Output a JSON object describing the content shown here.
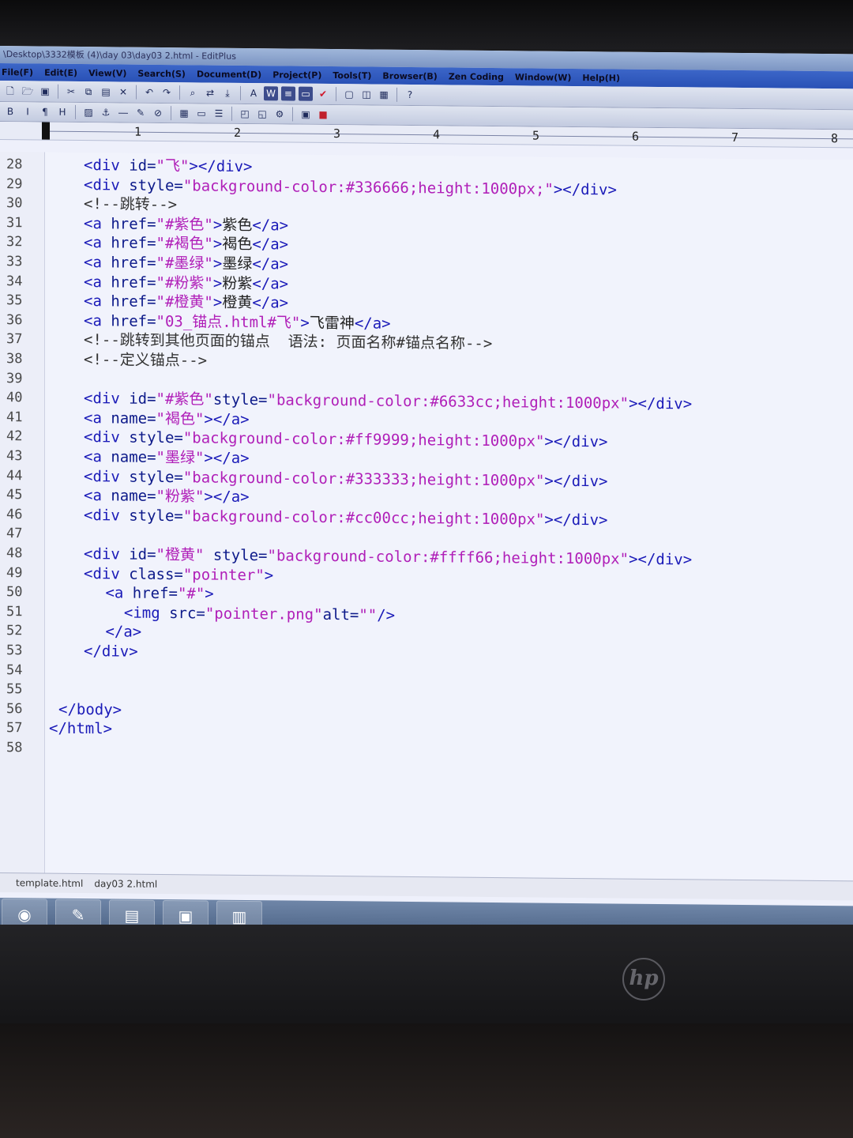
{
  "window": {
    "title": "\\Desktop\\3332模板 (4)\\day 03\\day03 2.html - EditPlus"
  },
  "menu": [
    "File(F)",
    "Edit(E)",
    "View(V)",
    "Search(S)",
    "Document(D)",
    "Project(P)",
    "Tools(T)",
    "Browser(B)",
    "Zen Coding",
    "Window(W)",
    "Help(H)"
  ],
  "ruler": [
    "1",
    "2",
    "3",
    "4",
    "5",
    "6",
    "7",
    "8"
  ],
  "lines": [
    {
      "n": "28",
      "code": [
        [
          "tag",
          "<div "
        ],
        [
          "attr",
          "id="
        ],
        [
          "str",
          "\"飞\""
        ],
        [
          "tag",
          "></div>"
        ]
      ]
    },
    {
      "n": "29",
      "code": [
        [
          "tag",
          "<div "
        ],
        [
          "attr",
          "style="
        ],
        [
          "str",
          "\"background-color:#336666;height:1000px;\""
        ],
        [
          "tag",
          "></div>"
        ]
      ]
    },
    {
      "n": "30",
      "code": [
        [
          "cmt",
          "<!--跳转-->"
        ]
      ]
    },
    {
      "n": "31",
      "code": [
        [
          "tag",
          "<a "
        ],
        [
          "attr",
          "href="
        ],
        [
          "str",
          "\"#紫色\""
        ],
        [
          "tag",
          ">"
        ],
        [
          "txt",
          "紫色"
        ],
        [
          "tag",
          "</a>"
        ]
      ]
    },
    {
      "n": "32",
      "code": [
        [
          "tag",
          "<a "
        ],
        [
          "attr",
          "href="
        ],
        [
          "str",
          "\"#褐色\""
        ],
        [
          "tag",
          ">"
        ],
        [
          "txt",
          "褐色"
        ],
        [
          "tag",
          "</a>"
        ]
      ]
    },
    {
      "n": "33",
      "code": [
        [
          "tag",
          "<a "
        ],
        [
          "attr",
          "href="
        ],
        [
          "str",
          "\"#墨绿\""
        ],
        [
          "tag",
          ">"
        ],
        [
          "txt",
          "墨绿"
        ],
        [
          "tag",
          "</a>"
        ]
      ]
    },
    {
      "n": "34",
      "code": [
        [
          "tag",
          "<a "
        ],
        [
          "attr",
          "href="
        ],
        [
          "str",
          "\"#粉紫\""
        ],
        [
          "tag",
          ">"
        ],
        [
          "txt",
          "粉紫"
        ],
        [
          "tag",
          "</a>"
        ]
      ]
    },
    {
      "n": "35",
      "code": [
        [
          "tag",
          "<a "
        ],
        [
          "attr",
          "href="
        ],
        [
          "str",
          "\"#橙黄\""
        ],
        [
          "tag",
          ">"
        ],
        [
          "txt",
          "橙黄"
        ],
        [
          "tag",
          "</a>"
        ]
      ]
    },
    {
      "n": "36",
      "code": [
        [
          "tag",
          "<a "
        ],
        [
          "attr",
          "href="
        ],
        [
          "str",
          "\"03_锚点.html#飞\""
        ],
        [
          "tag",
          ">"
        ],
        [
          "txt",
          "飞雷神"
        ],
        [
          "tag",
          "</a>"
        ]
      ]
    },
    {
      "n": "37",
      "code": [
        [
          "cmt",
          "<!--跳转到其他页面的锚点  语法: 页面名称#锚点名称-->"
        ]
      ]
    },
    {
      "n": "38",
      "code": [
        [
          "cmt",
          "<!--定义锚点-->"
        ]
      ]
    },
    {
      "n": "39",
      "code": []
    },
    {
      "n": "40",
      "code": [
        [
          "tag",
          "<div "
        ],
        [
          "attr",
          "id="
        ],
        [
          "str",
          "\"#紫色\""
        ],
        [
          "attr",
          "style="
        ],
        [
          "str",
          "\"background-color:#6633cc;height:1000px\""
        ],
        [
          "tag",
          "></div>"
        ]
      ]
    },
    {
      "n": "41",
      "code": [
        [
          "tag",
          "<a "
        ],
        [
          "attr",
          "name="
        ],
        [
          "str",
          "\"褐色\""
        ],
        [
          "tag",
          "></a>"
        ]
      ]
    },
    {
      "n": "42",
      "code": [
        [
          "tag",
          "<div "
        ],
        [
          "attr",
          "style="
        ],
        [
          "str",
          "\"background-color:#ff9999;height:1000px\""
        ],
        [
          "tag",
          "></div>"
        ]
      ]
    },
    {
      "n": "43",
      "code": [
        [
          "tag",
          "<a "
        ],
        [
          "attr",
          "name="
        ],
        [
          "str",
          "\"墨绿\""
        ],
        [
          "tag",
          "></a>"
        ]
      ]
    },
    {
      "n": "44",
      "code": [
        [
          "tag",
          "<div "
        ],
        [
          "attr",
          "style="
        ],
        [
          "str",
          "\"background-color:#333333;height:1000px\""
        ],
        [
          "tag",
          "></div>"
        ]
      ]
    },
    {
      "n": "45",
      "code": [
        [
          "tag",
          "<a "
        ],
        [
          "attr",
          "name="
        ],
        [
          "str",
          "\"粉紫\""
        ],
        [
          "tag",
          "></a>"
        ]
      ]
    },
    {
      "n": "46",
      "code": [
        [
          "tag",
          "<div "
        ],
        [
          "attr",
          "style="
        ],
        [
          "str",
          "\"background-color:#cc00cc;height:1000px\""
        ],
        [
          "tag",
          "></div>"
        ]
      ]
    },
    {
      "n": "47",
      "code": []
    },
    {
      "n": "48",
      "code": [
        [
          "tag",
          "<div "
        ],
        [
          "attr",
          "id="
        ],
        [
          "str",
          "\"橙黄\" "
        ],
        [
          "attr",
          "style="
        ],
        [
          "str",
          "\"background-color:#ffff66;height:1000px\""
        ],
        [
          "tag",
          "></div>"
        ]
      ]
    },
    {
      "n": "49",
      "code": [
        [
          "tag",
          "<div "
        ],
        [
          "attr",
          "class="
        ],
        [
          "str",
          "\"pointer\""
        ],
        [
          "tag",
          ">"
        ]
      ]
    },
    {
      "n": "50",
      "code": [
        [
          "tag",
          " <a "
        ],
        [
          "attr",
          "href="
        ],
        [
          "str",
          "\"#\""
        ],
        [
          "tag",
          ">"
        ]
      ]
    },
    {
      "n": "51",
      "code": [
        [
          "tag",
          "  <img "
        ],
        [
          "attr",
          "src="
        ],
        [
          "str",
          "\"pointer.png\""
        ],
        [
          "attr",
          "alt="
        ],
        [
          "str",
          "\"\""
        ],
        [
          "tag",
          "/>"
        ]
      ]
    },
    {
      "n": "52",
      "code": [
        [
          "tag",
          " </a>"
        ]
      ]
    },
    {
      "n": "53",
      "code": [
        [
          "tag",
          "</div>"
        ]
      ]
    },
    {
      "n": "54",
      "code": []
    },
    {
      "n": "55",
      "code": []
    },
    {
      "n": "56",
      "code": [
        [
          "tag",
          "</body>"
        ]
      ]
    },
    {
      "n": "57",
      "code": [
        [
          "tag",
          "</html>"
        ]
      ]
    },
    {
      "n": "58",
      "code": []
    }
  ],
  "file_tabs": [
    "template.html",
    "day03 2.html"
  ],
  "monitor_brand": "hp"
}
